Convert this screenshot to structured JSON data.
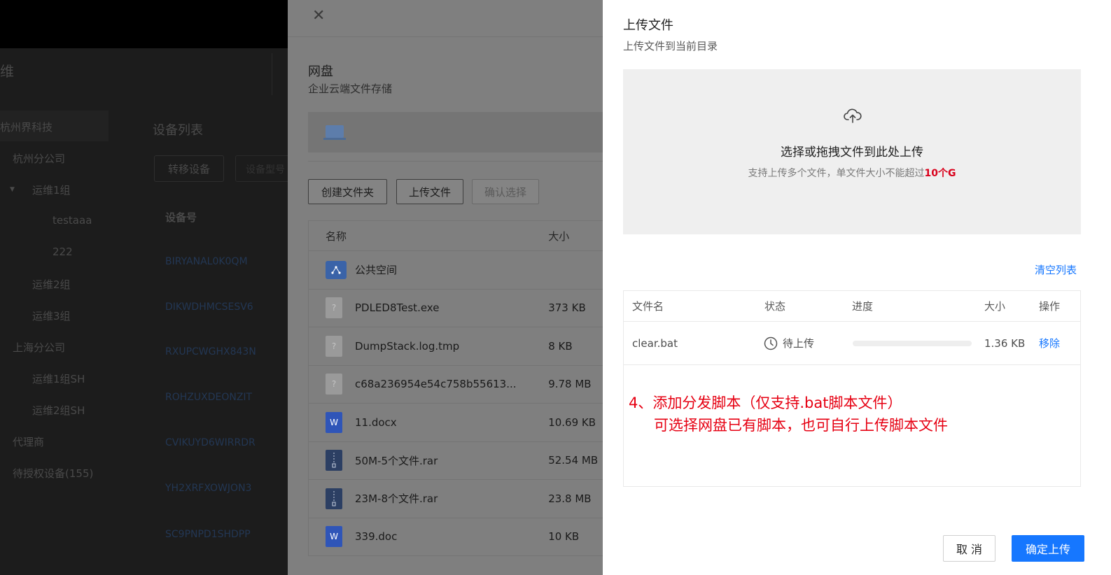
{
  "background": {
    "header_title": "维",
    "tree": [
      {
        "label": "杭州界科技"
      },
      {
        "label": "杭州分公司"
      },
      {
        "label": "运维1组"
      },
      {
        "label": "testaaa"
      },
      {
        "label": "222"
      },
      {
        "label": "运维2组"
      },
      {
        "label": "运维3组"
      },
      {
        "label": "上海分公司"
      },
      {
        "label": "运维1组SH"
      },
      {
        "label": "运维2组SH"
      },
      {
        "label": "代理商"
      },
      {
        "label": "待授权设备(155)"
      }
    ],
    "device_list_title": "设备列表",
    "transfer_button": "转移设备",
    "ghost_input": "设备型号",
    "column_device_no": "设备号",
    "device_ids": [
      "BIRYANAL0K0QM",
      "DIKWDHMCSESV6",
      "RXUPCWGHX843N",
      "ROHZUXDEONZIT",
      "CVIKUYD6WIRRDR",
      "YH2XRFXOWJON3",
      "SC9PNPD1SHDPP"
    ]
  },
  "drive": {
    "title": "网盘",
    "subtitle": "企业云端文件存储",
    "buttons": {
      "create_folder": "创建文件夹",
      "upload_file": "上传文件",
      "confirm_select": "确认选择"
    },
    "columns": {
      "name": "名称",
      "size": "大小"
    },
    "files": [
      {
        "name": "公共空间",
        "size": "",
        "icon": "folder-icon"
      },
      {
        "name": "PDLED8Test.exe",
        "size": "373 KB",
        "icon": "unknown-file-icon"
      },
      {
        "name": "DumpStack.log.tmp",
        "size": "8 KB",
        "icon": "unknown-file-icon"
      },
      {
        "name": "c68a236954e54c758b55613...",
        "size": "9.78 MB",
        "icon": "unknown-file-icon"
      },
      {
        "name": "11.docx",
        "size": "10.69 KB",
        "icon": "word-file-icon"
      },
      {
        "name": "50M-5个文件.rar",
        "size": "52.54 MB",
        "icon": "zip-file-icon"
      },
      {
        "name": "23M-8个文件.rar",
        "size": "23.8 MB",
        "icon": "zip-file-icon"
      },
      {
        "name": "339.doc",
        "size": "10 KB",
        "icon": "word-file-icon"
      }
    ],
    "unknown_glyph": "?",
    "word_glyph": "W"
  },
  "upload": {
    "title": "上传文件",
    "subtitle": "上传文件到当前目录",
    "dropzone_main": "选择或拖拽文件到此处上传",
    "dropzone_hint_prefix": "支持上传多个文件，单文件大小不能超过",
    "dropzone_hint_limit": "10个G",
    "clear_list": "清空列表",
    "columns": {
      "filename": "文件名",
      "status": "状态",
      "progress": "进度",
      "size": "大小",
      "action": "操作"
    },
    "rows": [
      {
        "filename": "clear.bat",
        "status": "待上传",
        "progress": 0,
        "size": "1.36 KB",
        "action": "移除"
      }
    ],
    "annotation_line1": "4、添加分发脚本（仅支持.bat脚本文件）",
    "annotation_line2": "可选择网盘已有脚本，也可自行上传脚本文件",
    "cancel": "取 消",
    "confirm": "确定上传"
  },
  "colors": {
    "primary": "#1677ff",
    "annotation": "#e60012",
    "limit_highlight": "#d9001b"
  }
}
